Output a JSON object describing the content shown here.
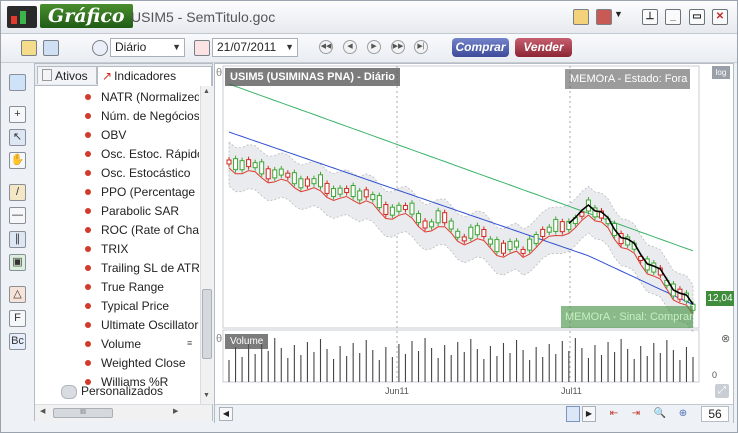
{
  "app": {
    "logo_text": "Gráfico",
    "title": "USIM5 - SemTitulo.goc"
  },
  "toolbar": {
    "period": "Diário",
    "date": "21/07/2011",
    "buy_label": "Comprar",
    "sell_label": "Vender"
  },
  "panel": {
    "tabs": [
      "Ativos",
      "Indicadores"
    ],
    "indicators": [
      "NATR (Normalized ATR)",
      "Núm. de Negócios",
      "OBV",
      "Osc. Estoc. Rápido",
      "Osc. Estocástico",
      "PPO (Percentage Price Oscillator)",
      "Parabolic SAR",
      "ROC (Rate of Change)",
      "TRIX",
      "Trailing SL de ATR",
      "True Range",
      "Typical Price",
      "Ultimate Oscillator",
      "Volume",
      "Weighted Close",
      "Williams %R"
    ],
    "custom_label": "Personalizados",
    "hscroll_grip": "III"
  },
  "chart": {
    "pane_title": "USIM5 (USIMINAS   PNA) - Diário",
    "memora_label": "MEMOrA - Estado: Fora",
    "log_label": "log",
    "last_price": "12,04",
    "signal_text": "MEMOrA - Sinal: Comprar",
    "volume_label": "Volume",
    "x_labels": [
      "Jun11",
      "Jul11"
    ],
    "volume_axis_zero": "0",
    "zoom_value": "56"
  },
  "colors": {
    "buy": "#3c4a9a",
    "sell": "#8c2433",
    "up_candle": "#3fa535",
    "down_candle": "#d02a20",
    "ma_green": "#3bb36a",
    "ma_blue": "#2f4fd0",
    "ma_red": "#e03a2f",
    "signal_line": "#000000"
  }
}
